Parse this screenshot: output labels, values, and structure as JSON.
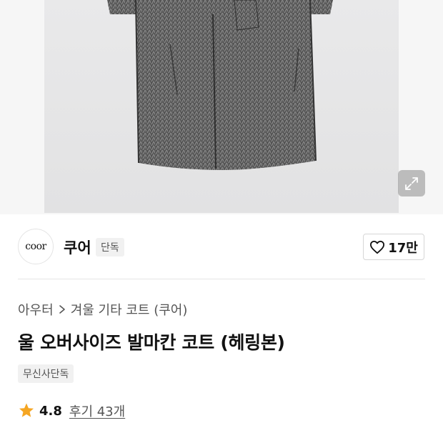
{
  "hero": {
    "image_alt": "herringbone wool coat",
    "expand_icon": "expand-icon"
  },
  "brand": {
    "logo_text": "coor",
    "name": "쿠어",
    "exclusive_tag": "단독",
    "like_count": "17만",
    "like_icon": "heart-outline-icon"
  },
  "breadcrumb": {
    "category": "아우터",
    "separator_icon": "chevron-right-icon",
    "subcategory": "겨울 기타 코트 (쿠어)"
  },
  "product": {
    "title": "울 오버사이즈 발마칸 코트 (헤링본)",
    "badge": "무신사단독"
  },
  "rating": {
    "star_icon": "star-icon",
    "star_color": "#f5a623",
    "score": "4.8",
    "reviews": "후기 43개"
  }
}
